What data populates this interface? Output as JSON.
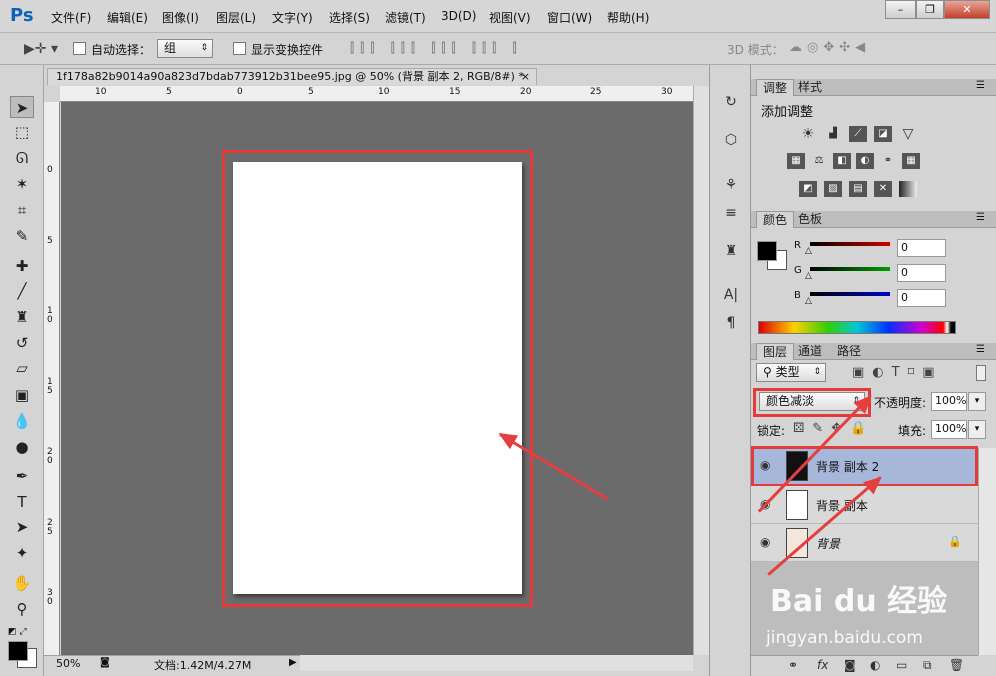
{
  "app": {
    "logo": "Ps"
  },
  "menu": [
    "文件(F)",
    "编辑(E)",
    "图像(I)",
    "图层(L)",
    "文字(Y)",
    "选择(S)",
    "滤镜(T)",
    "3D(D)",
    "视图(V)",
    "窗口(W)",
    "帮助(H)"
  ],
  "window_controls": {
    "minimize": "–",
    "restore": "❐",
    "close": "✕"
  },
  "options": {
    "auto_select_label": "自动选择：",
    "auto_select_value": "组",
    "show_transform_label": "显示变换控件",
    "mode_3d_label": "3D 模式："
  },
  "document": {
    "tab_title": "1f178a82b9014a90a823d7bdab773912b31bee95.jpg @ 50% (背景 副本 2, RGB/8#) *",
    "tab_close": "×",
    "ruler_h": [
      "10",
      "5",
      "0",
      "5",
      "10",
      "15",
      "20",
      "25",
      "30"
    ],
    "ruler_v": [
      "0",
      "5",
      "1 0",
      "1 5",
      "2 0",
      "2 5",
      "3 0"
    ],
    "zoom": "50%",
    "doc_info": "文档:1.42M/4.27M"
  },
  "adjustments": {
    "tabs": [
      "调整",
      "样式"
    ],
    "add_label": "添加调整"
  },
  "color": {
    "tabs": [
      "颜色",
      "色板"
    ],
    "channels": [
      {
        "label": "R",
        "value": "0",
        "color": "#cc0000"
      },
      {
        "label": "G",
        "value": "0",
        "color": "#00a000"
      },
      {
        "label": "B",
        "value": "0",
        "color": "#0000cc"
      }
    ]
  },
  "layers": {
    "tabs": [
      "图层",
      "通道",
      "路径"
    ],
    "filter_kind": "类型",
    "blend_mode": "颜色减淡",
    "opacity_label": "不透明度:",
    "opacity_value": "100%",
    "lock_label": "锁定:",
    "fill_label": "填充:",
    "fill_value": "100%",
    "items": [
      {
        "name": "背景 副本 2",
        "selected": true
      },
      {
        "name": "背景 副本",
        "selected": false
      },
      {
        "name": "背景",
        "selected": false,
        "locked": true
      }
    ],
    "footer_icons": [
      "link-icon",
      "fx-icon",
      "mask-icon",
      "adjustment-icon",
      "group-icon",
      "new-layer-icon",
      "trash-icon"
    ]
  },
  "watermark": {
    "brand": "Bai du 经验",
    "url": "jingyan.baidu.com"
  }
}
